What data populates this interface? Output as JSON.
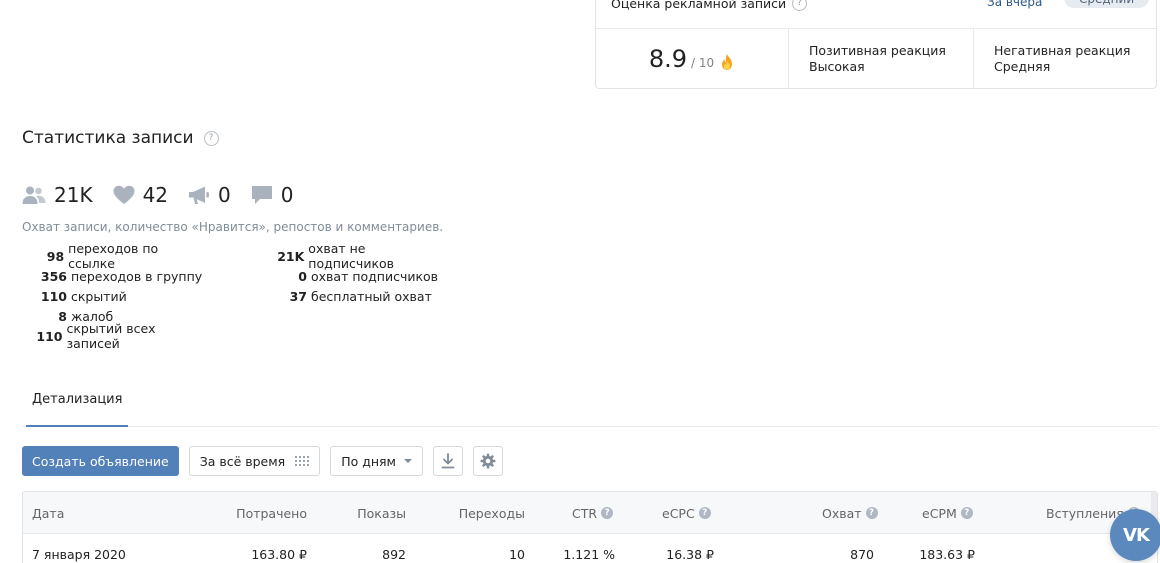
{
  "rating": {
    "title": "Оценка рекламной записи",
    "help": "?",
    "period_yesterday": "За вчера",
    "period_average": "Средний",
    "score": "8.9",
    "score_max": "/ 10",
    "positive_label": "Позитивная реакция",
    "positive_value": "Высокая",
    "negative_label": "Негативная реакция",
    "negative_value": "Средняя"
  },
  "stats": {
    "title": "Статистика записи",
    "help": "?",
    "counters": [
      {
        "icon": "users-icon",
        "value": "21K"
      },
      {
        "icon": "heart-icon",
        "value": "42"
      },
      {
        "icon": "megaphone-icon",
        "value": "0"
      },
      {
        "icon": "comment-icon",
        "value": "0"
      }
    ],
    "caption": "Охват записи, количество «Нравится», репостов и комментариев.",
    "left": [
      {
        "num": "98",
        "label": "переходов по ссылке"
      },
      {
        "num": "356",
        "label": "переходов в группу"
      },
      {
        "num": "110",
        "label": "скрытий"
      },
      {
        "num": "8",
        "label": "жалоб"
      },
      {
        "num": "110",
        "label": "скрытий всех записей"
      }
    ],
    "right": [
      {
        "num": "21K",
        "label": "охват не подписчиков"
      },
      {
        "num": "0",
        "label": "охват подписчиков"
      },
      {
        "num": "37",
        "label": "бесплатный охват"
      }
    ]
  },
  "tabs": {
    "details": "Детализация"
  },
  "toolbar": {
    "create_ad": "Создать объявление",
    "period": "За всё время",
    "grouping": "По дням"
  },
  "table": {
    "headers": {
      "date": "Дата",
      "spent": "Потрачено",
      "impressions": "Показы",
      "clicks": "Переходы",
      "ctr": "CTR",
      "ecpc": "eCPC",
      "reach": "Охват",
      "ecpm": "eCPM",
      "joins": "Вступления"
    },
    "row": {
      "date": "7 января 2020",
      "spent": "163.80 ₽",
      "impressions": "892",
      "clicks": "10",
      "ctr": "1.121 %",
      "ecpc": "16.38 ₽",
      "reach": "870",
      "ecpm": "183.63 ₽"
    },
    "help": "?"
  },
  "fab": {
    "label": "VK"
  },
  "colors": {
    "accent": "#5181b8",
    "link": "#2a5885",
    "muted": "#818c99",
    "fab": "#5b88bd"
  }
}
